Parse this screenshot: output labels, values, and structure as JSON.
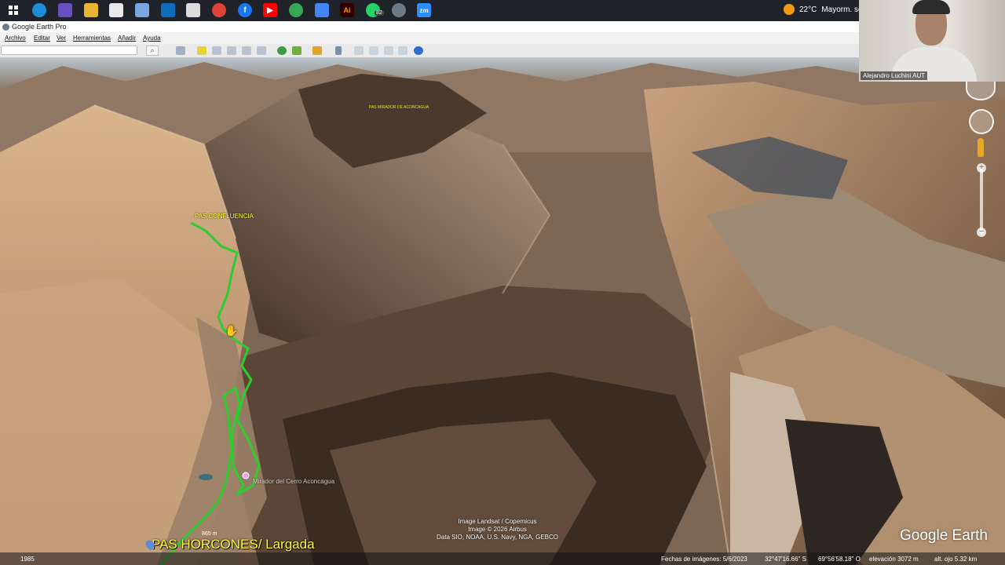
{
  "window": {
    "title": "Google Earth Pro"
  },
  "menu": {
    "items": [
      "Archivo",
      "Editar",
      "Ver",
      "Herramientas",
      "Añadir",
      "Ayuda"
    ]
  },
  "search": {
    "value": "",
    "placeholder": ""
  },
  "taskbar": {
    "icons": [
      "windows-icon",
      "edge-icon",
      "pen-icon",
      "folder-icon",
      "store-icon",
      "apps-icon",
      "outlook-icon",
      "mail-icon",
      "chrome-icon",
      "facebook-icon",
      "youtube-icon",
      "chrome-icon",
      "docs-icon",
      "illustrator-icon",
      "whatsapp-icon",
      "google-earth-icon",
      "zoom-icon"
    ],
    "whatsapp_badge": "82",
    "weather_temp": "22°C",
    "weather_text": "Mayorm. so"
  },
  "webcam": {
    "name": "Alejandro Luchini AUT"
  },
  "map": {
    "labels": {
      "confluencia": "PAS CONFLUENCIA",
      "mirador_small": "PAS MIRADOR DE ACONCAGUA",
      "horcones": "PAS HORCONES/ Largada",
      "mirador_aconcagua": "Mirador del Cerro Aconcagua",
      "elevation_marker": "865 m"
    },
    "attribution": [
      "Image Landsat / Copernicus",
      "Image © 2026 Airbus",
      "Data SIO, NOAA, U.S. Navy, NGA, GEBCO"
    ],
    "logo": "Google Earth",
    "route_color": "#2ecc2e"
  },
  "status": {
    "year": "1985",
    "imagery_date": "Fechas de imágenes: 5/6/2023",
    "lat": "32°47'16.66\" S",
    "lon": "69°56'58.18\" O",
    "elevation": "elevación  3072 m",
    "eye_alt": "alt. ojo   5.32 km"
  }
}
